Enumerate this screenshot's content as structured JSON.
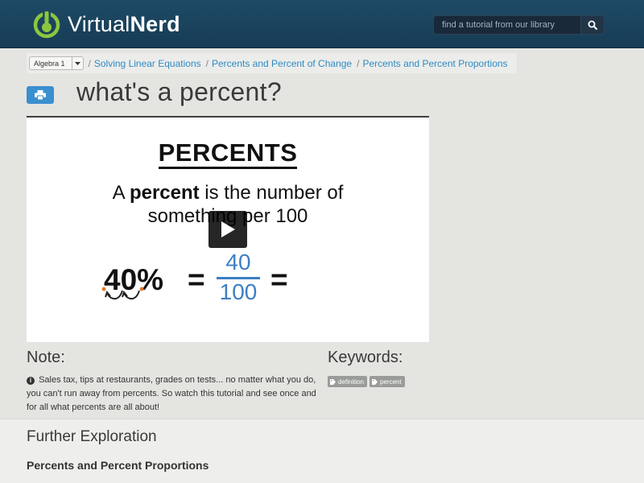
{
  "header": {
    "logo_light": "Virtual",
    "logo_bold": "Nerd",
    "search_placeholder": "find a tutorial from our library",
    "search_icon": "search-icon"
  },
  "breadcrumb": {
    "subject": "Algebra 1",
    "items": [
      "Solving Linear Equations",
      "Percents and Percent of Change",
      "Percents and Percent Proportions"
    ]
  },
  "page": {
    "title": "what's a percent?",
    "print_icon": "printer-icon"
  },
  "video": {
    "heading": "PERCENTS",
    "line1_pre": "A ",
    "line1_bold": "percent",
    "line1_post": " is the number of",
    "line2": "something per 100",
    "lhs": "40%",
    "eq": "=",
    "numerator": "40",
    "denominator": "100",
    "play_icon": "play-icon"
  },
  "note": {
    "heading": "Note:",
    "text": "Sales tax, tips at restaurants, grades on tests... no matter what you do, you can't run away from percents. So watch this tutorial and see once and for all what percents are all about!"
  },
  "keywords": {
    "heading": "Keywords:",
    "tags": [
      "definition",
      "percent"
    ]
  },
  "further": {
    "heading": "Further Exploration",
    "link": "Percents and Percent Proportions"
  },
  "colors": {
    "header_bg": "#1e4a66",
    "link": "#2f8ac4",
    "accent_blue": "#3a8fcf",
    "logo_green": "#8cc63f",
    "fraction_blue": "#3d7fc4"
  }
}
